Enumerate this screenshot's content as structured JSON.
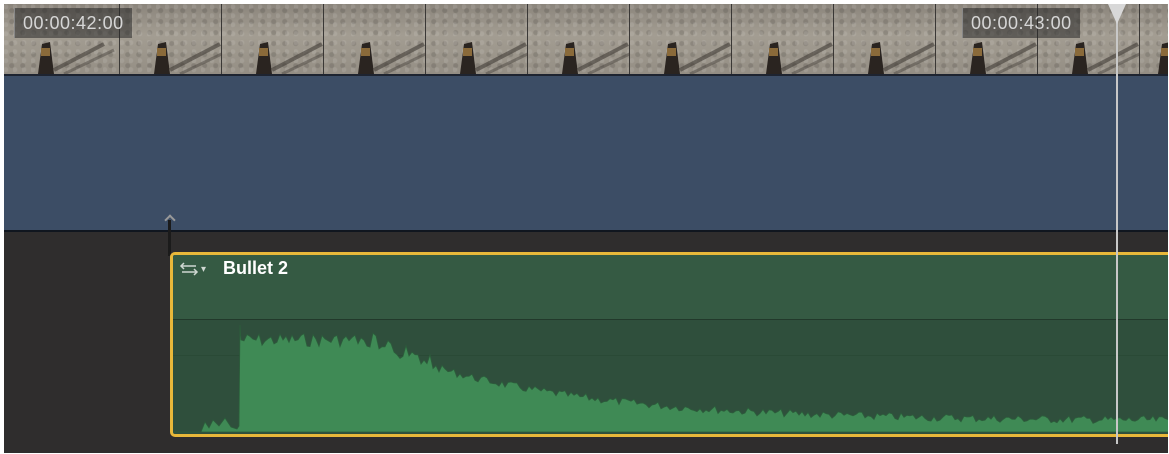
{
  "timeline": {
    "timecodes": [
      "00:00:42:00",
      "00:00:43:00"
    ],
    "audio_clip": {
      "name": "Bullet 2",
      "icon": "clip-swap-icon",
      "border_color": "#e8b83a",
      "waveform_color": "#3f8a55"
    },
    "video_clip": {
      "color": "#3c4d65"
    },
    "playhead": {
      "color": "#d8d8d8"
    }
  }
}
